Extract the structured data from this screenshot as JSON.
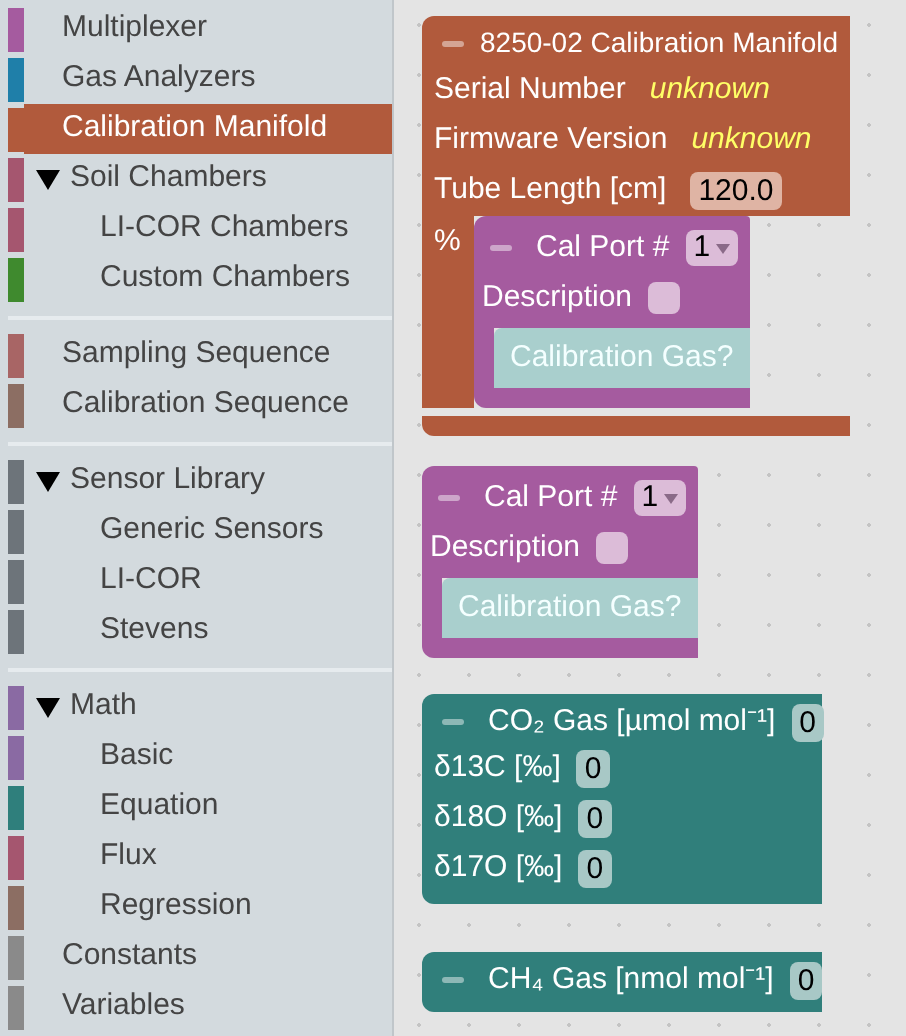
{
  "sidebar": {
    "sections": [
      [
        {
          "label": "Multiplexer",
          "color": "#a55b9f",
          "selected": false
        },
        {
          "label": "Gas Analyzers",
          "color": "#1f7fa9",
          "selected": false
        },
        {
          "label": "Calibration Manifold",
          "color": "#b15a3c",
          "selected": true
        },
        {
          "label": "Soil Chambers",
          "color": "#a5566f",
          "selected": false,
          "expanded": true,
          "children": [
            {
              "label": "LI-COR Chambers",
              "color": "#a5566f",
              "selected": false
            },
            {
              "label": "Custom Chambers",
              "color": "#3f8a2e",
              "selected": false
            }
          ]
        }
      ],
      [
        {
          "label": "Sampling Sequence",
          "color": "#a86565",
          "selected": false
        },
        {
          "label": "Calibration Sequence",
          "color": "#8c6e63",
          "selected": false
        }
      ],
      [
        {
          "label": "Sensor Library",
          "color": "#6d747a",
          "selected": false,
          "expanded": true,
          "children": [
            {
              "label": "Generic Sensors",
              "color": "#6d747a",
              "selected": false
            },
            {
              "label": "LI-COR",
              "color": "#6d747a",
              "selected": false
            },
            {
              "label": "Stevens",
              "color": "#6d747a",
              "selected": false
            }
          ]
        }
      ],
      [
        {
          "label": "Math",
          "color": "#8a6aa3",
          "selected": false,
          "expanded": true,
          "children": [
            {
              "label": "Basic",
              "color": "#8a6aa3",
              "selected": false
            },
            {
              "label": "Equation",
              "color": "#2f7f7c",
              "selected": false
            },
            {
              "label": "Flux",
              "color": "#a5566f",
              "selected": false
            },
            {
              "label": "Regression",
              "color": "#8c6e63",
              "selected": false
            }
          ]
        },
        {
          "label": "Constants",
          "color": "#8a8a8a",
          "selected": false
        },
        {
          "label": "Variables",
          "color": "#8a8a8a",
          "selected": false
        }
      ]
    ]
  },
  "workspace": {
    "blocks": [
      {
        "kind": "manifold",
        "color": "#b15a3c",
        "title": "8250-02 Calibration Manifold",
        "fields": [
          {
            "label": "Serial Number",
            "value": "unknown",
            "kind": "text"
          },
          {
            "label": "Firmware Version",
            "value": "unknown",
            "kind": "text"
          },
          {
            "label": "Tube Length [cm]",
            "value": "120.0",
            "kind": "number"
          }
        ],
        "statement_label": "%",
        "children": [
          {
            "kind": "cal_port",
            "color": "#a55b9f",
            "title": "Cal Port #",
            "dropdown": "1",
            "description_label": "Description",
            "comment": "Calibration Gas?"
          }
        ]
      },
      {
        "kind": "cal_port",
        "color": "#a55b9f",
        "title": "Cal Port #",
        "dropdown": "1",
        "description_label": "Description",
        "comment": "Calibration Gas?"
      },
      {
        "kind": "gas",
        "color": "#307f7b",
        "title": "CO₂ Gas [µmol mol⁻¹]",
        "value": "0",
        "fields": [
          {
            "label": "δ13C [‰]",
            "value": "0"
          },
          {
            "label": "δ18O [‰]",
            "value": "0"
          },
          {
            "label": "δ17O [‰]",
            "value": "0"
          }
        ]
      },
      {
        "kind": "gas",
        "color": "#307f7b",
        "title": "CH₄ Gas [nmol mol⁻¹]",
        "value": "0"
      }
    ]
  }
}
